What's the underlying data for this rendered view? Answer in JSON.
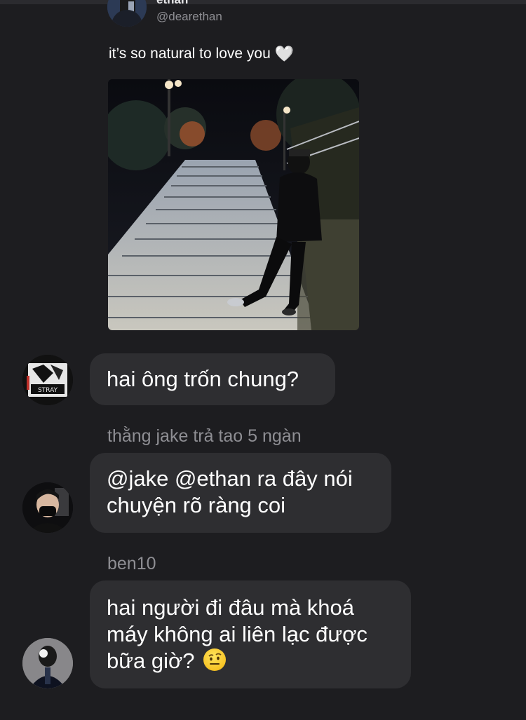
{
  "post": {
    "author_name": "ethan",
    "author_handle": "@dearethan",
    "text": "it’s so natural to love you",
    "heart": "🤍"
  },
  "comments": [
    {
      "author": "",
      "lines": [
        "hai ông trốn chung?"
      ]
    },
    {
      "author": "thằng jake trả tao 5 ngàn",
      "lines": [
        "@jake @ethan ra đây nói",
        "chuyện rõ ràng coi"
      ]
    },
    {
      "author": "ben10",
      "lines": [
        "hai người đi đâu mà khoá",
        "máy không ai liên lạc được",
        "bữa giờ?"
      ],
      "emoji": "face-with-raised-eyebrow"
    }
  ],
  "colors": {
    "background": "#1d1d20",
    "bubble": "#2e2e31",
    "secondary_text": "#8e8e93"
  }
}
